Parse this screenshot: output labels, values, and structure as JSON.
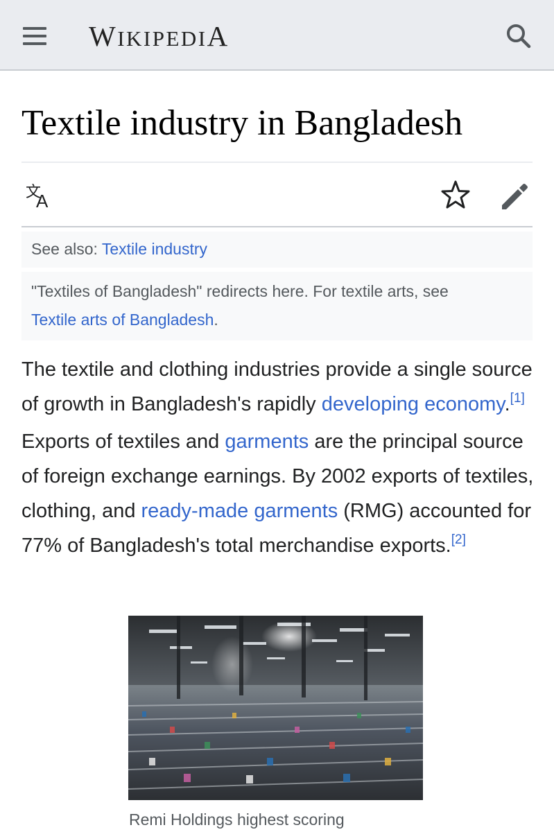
{
  "header": {
    "logo_first": "W",
    "logo_mid": "IKIPEDI",
    "logo_last": "A",
    "menu_icon": "hamburger-menu-icon",
    "search_icon": "search-icon",
    "background": "#eaecf0"
  },
  "page": {
    "title": "Textile industry in Bangladesh"
  },
  "toolbar": {
    "language_icon": "language-icon",
    "watch_icon": "star-icon",
    "edit_icon": "pencil-icon"
  },
  "hatnotes": {
    "see_also_label": "See also: ",
    "see_also_link": "Textile industry",
    "redirect_text": "\"Textiles of Bangladesh\" redirects here. For textile arts, see",
    "redirect_link": "Textile arts of Bangladesh",
    "redirect_end": "."
  },
  "lead": {
    "t1": "The textile and clothing industries provide a single source of growth in Bangladesh's rapidly ",
    "l1": "developing economy",
    "t2": ".",
    "ref1": "[1]",
    "t3": " Exports of textiles and ",
    "l2": "garments",
    "t4": " are the principal source of foreign exchange earnings. By 2002 exports of textiles, clothing, and ",
    "l3": "ready-made garments",
    "t5": " (RMG) accounted for 77% of Bangladesh's total merchandise exports.",
    "ref2": "[2]"
  },
  "figure": {
    "caption": "Remi Holdings highest scoring"
  },
  "colors": {
    "link": "#3366cc",
    "text": "#202122",
    "muted": "#54595d",
    "hatnote_bg": "#f8f9fa"
  }
}
